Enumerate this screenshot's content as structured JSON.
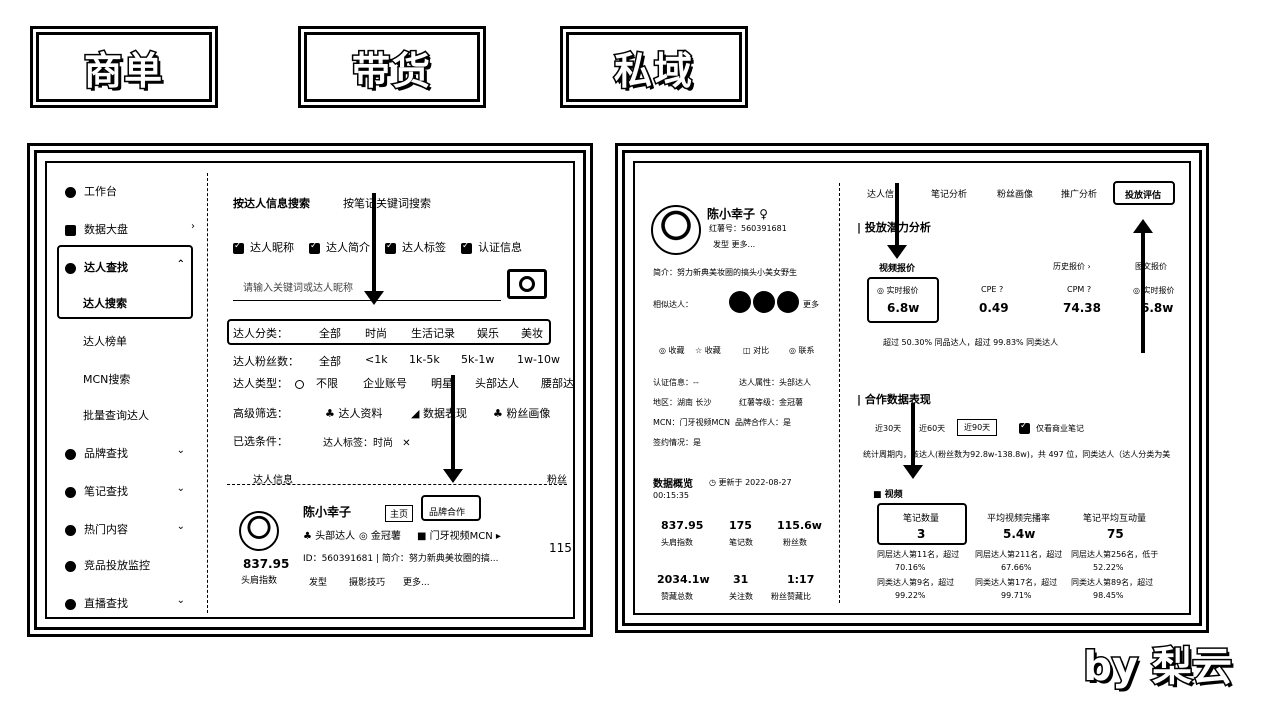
{
  "tabs": [
    "商单",
    "带货",
    "私域"
  ],
  "left": {
    "sidebar": [
      {
        "label": "工作台",
        "chev": ""
      },
      {
        "label": "数据大盘",
        "chev": "›"
      },
      {
        "label": "达人查找",
        "chev": "⌃"
      },
      {
        "label": "达人搜索",
        "chev": ""
      },
      {
        "label": "达人榜单",
        "chev": ""
      },
      {
        "label": "MCN搜索",
        "chev": ""
      },
      {
        "label": "批量查询达人",
        "chev": ""
      },
      {
        "label": "品牌查找",
        "chev": "⌄"
      },
      {
        "label": "笔记查找",
        "chev": "⌄"
      },
      {
        "label": "热门内容",
        "chev": "⌄"
      },
      {
        "label": "竞品投放监控",
        "chev": ""
      },
      {
        "label": "直播查找",
        "chev": "⌄"
      }
    ],
    "search_tabs": [
      "按达人信息搜索",
      "按笔记关键词搜索"
    ],
    "checkboxes": [
      "达人昵称",
      "达人简介",
      "达人标签",
      "认证信息"
    ],
    "search_placeholder": "请输入关键词或达人昵称",
    "category_label": "达人分类：",
    "categories": [
      "全部",
      "时尚",
      "生活记录",
      "娱乐",
      "美妆"
    ],
    "fans_label": "达人粉丝数：",
    "fans": [
      "全部",
      "<1k",
      "1k-5k",
      "5k-1w",
      "1w-10w"
    ],
    "type_label": "达人类型：",
    "types": [
      "不限",
      "企业账号",
      "明星",
      "头部达人",
      "腰部达"
    ],
    "advanced_label": "高级筛选：",
    "advanced": [
      "达人资料",
      "数据表现",
      "粉丝画像"
    ],
    "selected_label": "已选条件：",
    "selected_value": "达人标签：时尚",
    "col_header": "达人信息",
    "col_header2": "粉丝",
    "influencer_name": "陈小幸子",
    "btn_homepage": "主页",
    "btn_brand": "品牌合作",
    "tag_top": "头部达人",
    "tag_gold": "金冠薯",
    "mcn": "门牙视频MCN",
    "id_line": "ID：560391681 | 简介：努力新典美妆圈的搞...",
    "score": "837.95",
    "score_label": "头肩指数",
    "links": [
      "发型",
      "摄影技巧",
      "更多..."
    ],
    "right_num": "115"
  },
  "right": {
    "name": "陈小幸子",
    "redbook_id": "红薯号：560391681",
    "tags": "发型   更多...",
    "bio": "简介：努力新典美妆圈的搞头小美女野生",
    "similar_label": "相似达人：",
    "more": "更多",
    "actions": [
      "收藏",
      "收藏",
      "对比",
      "联系"
    ],
    "info_rows": [
      [
        "认证信息：--",
        "达人属性：头部达人"
      ],
      [
        "地区：湖南 长沙",
        "红薯等级：金冠薯"
      ],
      [
        "MCN：门牙视频MCN",
        "品牌合作人：是"
      ],
      [
        "签约情况：是",
        ""
      ]
    ],
    "top_tabs": [
      "达人信",
      "笔记分析",
      "粉丝画像",
      "推广分析",
      "投放评估"
    ],
    "section_title": "投放潜力分析",
    "video_quote": "视频报价",
    "history_quote": "历史报价",
    "image_quote": "图文报价",
    "metrics": [
      {
        "label": "实时报价",
        "value": "6.8w"
      },
      {
        "label": "CPE",
        "value": "0.49"
      },
      {
        "label": "CPM",
        "value": "74.38"
      },
      {
        "label": "实时报价",
        "value": "6.8w"
      }
    ],
    "beat_text": "超过 50.30% 同品达人，超过 99.83% 同类达人",
    "coop_title": "合作数据表现",
    "periods": [
      "近30天",
      "近60天",
      "近90天"
    ],
    "only_commercial": "仅看商业笔记",
    "coop_desc": "统计周期内，该达人(粉丝数为92.8w-138.8w)，共 497 位，同类达人（达人分类为美",
    "video_label": "视频",
    "stats": [
      {
        "label": "笔记数量",
        "value": "3",
        "foot1": "同层达人第11名，超过",
        "foot2": "70.16%",
        "foot3": "同类达人第9名，超过",
        "foot4": "99.22%"
      },
      {
        "label": "平均视频完播率",
        "value": "5.4w",
        "foot1": "同层达人第211名，超过",
        "foot2": "67.66%",
        "foot3": "同类达人第17名，超过",
        "foot4": "99.71%"
      },
      {
        "label": "笔记平均互动量",
        "value": "75",
        "foot1": "同层达人第256名，低于",
        "foot2": "52.22%",
        "foot3": "同类达人第89名，超过",
        "foot4": "98.45%"
      }
    ],
    "overview_label": "数据概览",
    "update_time": "更新于 2022-08-27",
    "update_time2": "00:15:35",
    "overview": [
      {
        "value": "837.95",
        "label": "头肩指数"
      },
      {
        "value": "175",
        "label": "笔记数"
      },
      {
        "value": "115.6w",
        "label": "粉丝数"
      },
      {
        "value": "2034.1w",
        "label": "赞藏总数"
      },
      {
        "value": "31",
        "label": "关注数"
      },
      {
        "value": "1:17",
        "label": "粉丝赞藏比"
      }
    ]
  },
  "signature": "by 梨云"
}
